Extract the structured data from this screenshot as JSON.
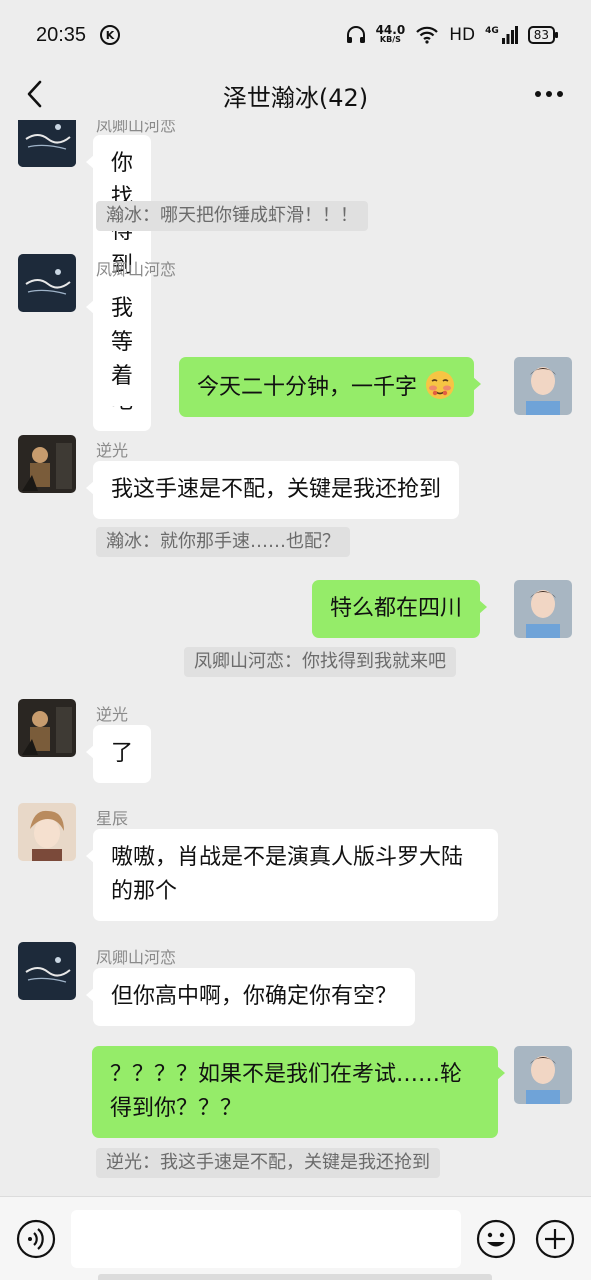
{
  "status_bar": {
    "time": "20:35",
    "carrier_badge": "K",
    "net_speed_value": "44.0",
    "net_speed_unit": "KB/S",
    "hd": "HD",
    "signal_label": "4G",
    "battery": "83"
  },
  "header": {
    "title": "泽世瀚冰(42)"
  },
  "messages": [
    {
      "side": "left",
      "sender": "凤卿山河恋",
      "text": "你找得到我就来吧",
      "quote": "瀚冰：哪天把你锤成虾滑！！！"
    },
    {
      "side": "left",
      "sender": "凤卿山河恋",
      "text": "我等着"
    },
    {
      "side": "right",
      "text": "今天二十分钟，一千字"
    },
    {
      "side": "left",
      "sender": "逆光",
      "text": "我这手速是不配，关键是我还抢到",
      "quote": "瀚冰：就你那手速……也配？"
    },
    {
      "side": "right",
      "text": "特么都在四川",
      "quote": "凤卿山河恋：你找得到我就来吧"
    },
    {
      "side": "left",
      "sender": "逆光",
      "text": "了"
    },
    {
      "side": "left",
      "sender": "星辰",
      "text": "嗷嗷，肖战是不是演真人版斗罗大陆的那个"
    },
    {
      "side": "left",
      "sender": "凤卿山河恋",
      "text": "但你高中啊，你确定你有空？"
    },
    {
      "side": "right",
      "text": "？？？？如果不是我们在考试……轮得到你？？？",
      "quote": "逆光：我这手速是不配，关键是我还抢到"
    }
  ],
  "colors": {
    "background": "#ededed",
    "bubble_self": "#95ec69",
    "bubble_other": "#ffffff",
    "quote_bg": "#e0e0e0"
  },
  "icons": {
    "back": "chevron-left-icon",
    "more": "more-dots-icon",
    "voice": "voice-icon",
    "emoji": "emoji-icon",
    "plus": "plus-icon",
    "blush_emoji": "blush-emoji-icon"
  },
  "input": {
    "value": ""
  }
}
